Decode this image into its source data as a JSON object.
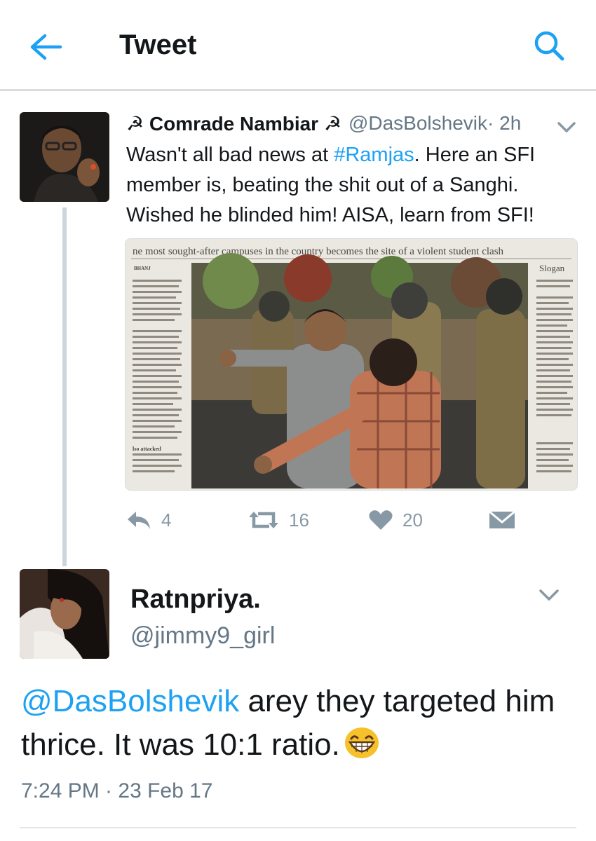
{
  "header": {
    "title": "Tweet",
    "back_icon": "back-arrow-icon",
    "search_icon": "search-icon"
  },
  "colors": {
    "accent": "#1da1f2",
    "text": "#14171a",
    "muted": "#657786",
    "icon": "#8899a6"
  },
  "tweet1": {
    "author_name": "☭ Comrade Nambiar ☭",
    "handle": "@DasBolshevik",
    "time": " · 2h",
    "text_prefix": "Wasn't all bad news at ",
    "hashtag": "#Ramjas",
    "text_suffix": ". Here an SFI member is, beating the shit out of a Sanghi. Wished he blinded him! AISA, learn from SFI!",
    "media": {
      "headline": "ne most sought-after campuses in the country becomes the site of a violent student clash",
      "side_label": "Slogan",
      "sub_label": "BHANJ",
      "bottom_label": "lso attacked"
    },
    "actions": {
      "reply_count": "4",
      "retweet_count": "16",
      "like_count": "20"
    }
  },
  "tweet2": {
    "author_name": "Ratnpriya.",
    "handle": "@jimmy9_girl",
    "mention": "@DasBolshevik",
    "text": " arey they targeted him thrice. It was 10:1 ratio.",
    "emoji_icon": "grinning-face-icon",
    "timestamp": "7:24 PM · 23 Feb 17"
  }
}
